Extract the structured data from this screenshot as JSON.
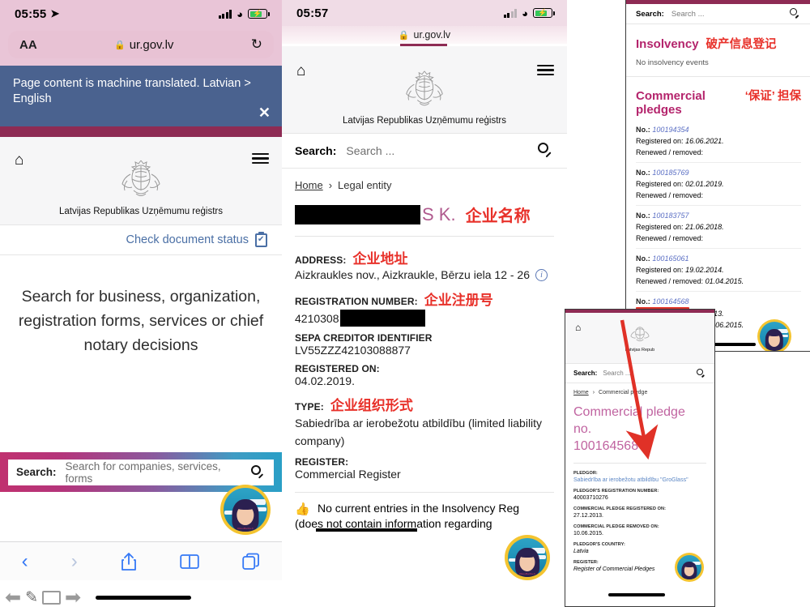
{
  "left_panel": {
    "status": {
      "time": "05:55",
      "location_icon": "location-arrow-icon",
      "signal": "signal-bars-icon",
      "wifi": "wifi-icon",
      "battery": "battery-charging-icon"
    },
    "browser": {
      "text_size_label": "AA",
      "lock_icon": "lock-icon",
      "url": "ur.gov.lv",
      "reload_icon": "reload-icon"
    },
    "translate_banner": {
      "text": "Page content is machine translated. Latvian > English",
      "close_icon": "close-icon"
    },
    "site_header": {
      "home_icon": "home-icon",
      "menu_icon": "hamburger-menu-icon",
      "crest_icon": "latvia-coat-of-arms-icon",
      "site_name": "Latvijas Republikas Uzņēmumu reģistrs"
    },
    "doc_status": {
      "label": "Check document status",
      "icon": "clipboard-check-icon"
    },
    "hero_text": "Search for business, organization, registration forms, services or chief notary decisions",
    "search": {
      "label": "Search:",
      "placeholder": "Search for companies, services, forms",
      "icon": "search-icon"
    },
    "toolbar": {
      "back_icon": "back-chevron-icon",
      "forward_icon": "forward-chevron-icon",
      "share_icon": "share-icon",
      "bookmarks_icon": "book-icon",
      "tabs_icon": "tabs-icon"
    },
    "a11y_toolbar": {
      "back_icon": "left-arrow-icon",
      "pen_icon": "pen-icon",
      "list_icon": "list-icon",
      "forward_icon": "right-arrow-icon"
    }
  },
  "middle_panel": {
    "status": {
      "time": "05:57",
      "signal": "signal-bars-icon",
      "wifi": "wifi-icon",
      "battery": "battery-charging-icon"
    },
    "browser": {
      "lock_icon": "lock-icon",
      "url": "ur.gov.lv"
    },
    "site_header": {
      "home_icon": "home-icon",
      "menu_icon": "hamburger-menu-icon",
      "crest_icon": "latvia-coat-of-arms-icon",
      "site_name": "Latvijas Republikas Uzņēmumu reģistrs"
    },
    "search": {
      "label": "Search:",
      "placeholder": "Search ...",
      "icon": "search-icon"
    },
    "breadcrumb": {
      "home": "Home",
      "separator": "›",
      "current": "Legal entity"
    },
    "company_title": {
      "redacted": true,
      "visible_suffix": "S K.",
      "annotation_zh": "企业名称"
    },
    "fields": [
      {
        "label": "ADDRESS:",
        "annotation_zh": "企业地址",
        "value": "Aizkraukles nov., Aizkraukle, Bērzu iela 12 - 26",
        "info_icon": "info-icon"
      },
      {
        "label": "REGISTRATION NUMBER:",
        "annotation_zh": "企业注册号",
        "value": "4210308",
        "redacted_tail": true
      },
      {
        "label": "SEPA CREDITOR IDENTIFIER",
        "annotation_zh": "",
        "value": "LV55ZZZ42103088877"
      },
      {
        "label": "REGISTERED ON:",
        "annotation_zh": "",
        "value": "04.02.2019."
      },
      {
        "label": "TYPE:",
        "annotation_zh": "企业组织形式",
        "value": "Sabiedrība ar ierobežotu atbildību (limited liability company)"
      },
      {
        "label": "REGISTER:",
        "annotation_zh": "",
        "value": "Commercial Register"
      }
    ],
    "insolvency_note": {
      "icon": "thumbs-up-icon",
      "line1": "No current entries in the Insolvency Reg",
      "line2": "(does not contain information regarding"
    }
  },
  "right_panel": {
    "search": {
      "label": "Search:",
      "placeholder": "Search ...",
      "icon": "search-icon"
    },
    "insolvency": {
      "title": "Insolvency",
      "annotation_zh": "破产信息登记",
      "body": "No insolvency events"
    },
    "pledges": {
      "title": "Commercial pledges",
      "annotation_zh": "‘保证’ 担保",
      "labels": {
        "no": "No.:",
        "registered": "Registered on:",
        "renewed": "Renewed / removed:"
      },
      "items": [
        {
          "no": "100194354",
          "registered": "16.06.2021.",
          "renewed": ""
        },
        {
          "no": "100185769",
          "registered": "02.01.2019.",
          "renewed": ""
        },
        {
          "no": "100183757",
          "registered": "21.06.2018.",
          "renewed": ""
        },
        {
          "no": "100165061",
          "registered": "19.02.2014.",
          "renewed": "01.04.2015."
        },
        {
          "no": "100164568",
          "registered": "27.12.2013.",
          "renewed": "10.06.2015.",
          "highlighted": true
        }
      ]
    }
  },
  "detail_panel": {
    "site_header": {
      "home_icon": "home-icon",
      "crest_icon": "latvia-coat-of-arms-icon",
      "site_name": "Latvijas Repub"
    },
    "search": {
      "label": "Search:",
      "placeholder": "Search ...",
      "icon": "search-icon"
    },
    "breadcrumb": {
      "home": "Home",
      "separator": "›",
      "current": "Commercial pledge"
    },
    "title_line1": "Commercial pledge no.",
    "title_line2": "100164568",
    "fields": [
      {
        "label": "PLEDGOR:",
        "value": "Sabiedrība ar ierobežotu atbildību \"GroGlass\"",
        "link": true
      },
      {
        "label": "PLEDGOR'S REGISTRATION NUMBER:",
        "value": "40003710276"
      },
      {
        "label": "COMMERCIAL PLEDGE REGISTERED ON:",
        "value": "27.12.2013."
      },
      {
        "label": "COMMERCIAL PLEDGE REMOVED ON:",
        "value": "10.06.2015."
      },
      {
        "label": "PLEDGOR'S COUNTRY:",
        "value": "Latvia",
        "italic": true
      },
      {
        "label": "REGISTER:",
        "value": "Register of Commercial Pledges",
        "italic": true
      }
    ]
  },
  "annotations": {
    "arrow": "red-arrow-connector",
    "underline": "red-underline-highlight"
  },
  "colors": {
    "maroon": "#8e2b54",
    "magenta": "#b4246c",
    "red_annotation": "#e8312a",
    "link_blue": "#5b6fc4",
    "banner_blue": "#4a628f",
    "urlbar_pink": "#e8c2d4",
    "ios_blue": "#3478f6"
  }
}
